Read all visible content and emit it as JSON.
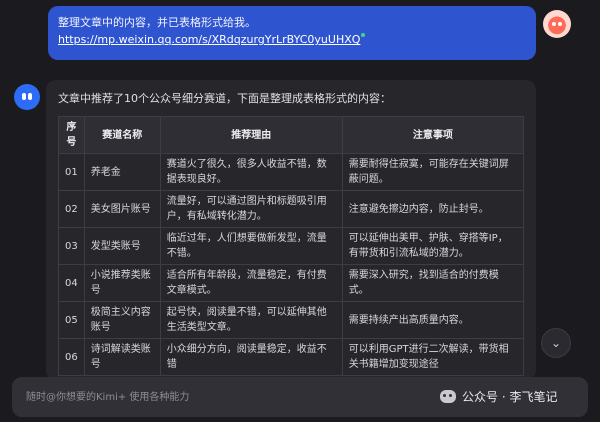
{
  "user_message": {
    "text": "整理文章中的内容，并已表格形式给我。",
    "link": "https://mp.weixin.qq.com/s/XRdqzurgYrLrBYC0yuUHXQ"
  },
  "bot_message": {
    "intro": "文章中推荐了10个公众号细分赛道，下面是整理成表格形式的内容：",
    "table": {
      "headers": [
        "序号",
        "赛道名称",
        "推荐理由",
        "注意事项"
      ],
      "rows": [
        [
          "01",
          "养老金",
          "赛道火了很久，很多人收益不错，数据表现良好。",
          "需要耐得住寂寞，可能存在关键词屏蔽问题。"
        ],
        [
          "02",
          "美女图片账号",
          "流量好，可以通过图片和标题吸引用户，有私域转化潜力。",
          "注意避免擦边内容，防止封号。"
        ],
        [
          "03",
          "发型类账号",
          "临近过年，人们想要做新发型，流量不错。",
          "可以延伸出美甲、护肤、穿搭等IP，有带货和引流私域的潜力。"
        ],
        [
          "04",
          "小说推荐类账号",
          "适合所有年龄段，流量稳定，有付费文章模式。",
          "需要深入研究，找到适合的付费模式。"
        ],
        [
          "05",
          "极简主义内容账号",
          "起号快，阅读量不错，可以延伸其他生活类型文章。",
          "需要持续产出高质量内容。"
        ],
        [
          "06",
          "诗词解读类账号",
          "小众细分方向，阅读量稳定，收益不错",
          "可以利用GPT进行二次解读，带货相关书籍增加变现途径"
        ]
      ]
    }
  },
  "input": {
    "placeholder": "随时@你想要的Kimi+ 使用各种能力"
  },
  "watermark": {
    "text": "公众号 · 李飞笔记"
  },
  "icons": {
    "scroll": "chevron-double-down-icon"
  },
  "colors": {
    "background": "#1b1b1f",
    "user_bubble": "#2f54cf",
    "bot_card": "#26262b",
    "accent": "#2c6cf6"
  }
}
